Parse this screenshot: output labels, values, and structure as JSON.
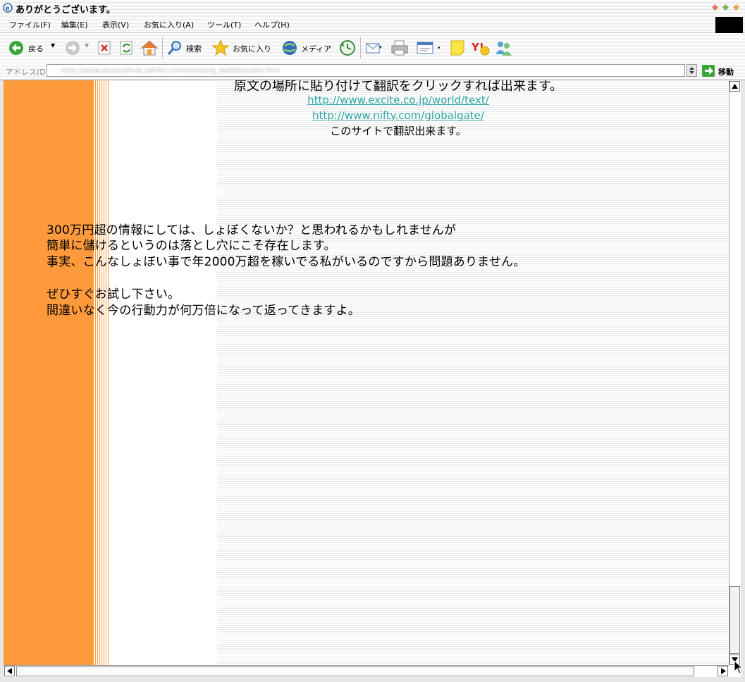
{
  "window": {
    "title": "ありがとうございます。"
  },
  "menu": [
    "ファイル(F)",
    "編集(E)",
    "表示(V)",
    "お気に入り(A)",
    "ツール(T)",
    "ヘルプ(H)"
  ],
  "toolbar": {
    "back_label": "戻る",
    "search_label": "検索",
    "favorites_label": "お気に入り",
    "media_label": "メディア"
  },
  "address": {
    "label": "アドレス(D)",
    "value": "http://www.ahasicbhuk.sahiko.com/textlang_wellhb/index.htm",
    "go_label": "移動"
  },
  "content": {
    "partial_heading": "原文の場所に貼り付けて翻訳をクリックすれば出来ます。",
    "links": [
      "http://www.excite.co.jp/world/text/",
      "http://www.nifty.com/globalgate/"
    ],
    "translate_note": "このサイトで翻訳出来ます。",
    "paragraph1": [
      "300万円超の情報にしては、しょぼくないか？と思われるかもしれませんが",
      "簡単に儲けるというのは落とし穴にこそ存在します。",
      "事実、こんなしょぼい事で年2000万超を稼いでる私がいるのですから問題ありません。"
    ],
    "paragraph2": [
      "ぜひすぐお試し下さい。",
      "間違いなく今の行動力が何万倍になって返ってきますよ。"
    ]
  },
  "colors": {
    "sidebar_orange": "#ff9a3c",
    "link_teal": "#2aa5a5"
  }
}
